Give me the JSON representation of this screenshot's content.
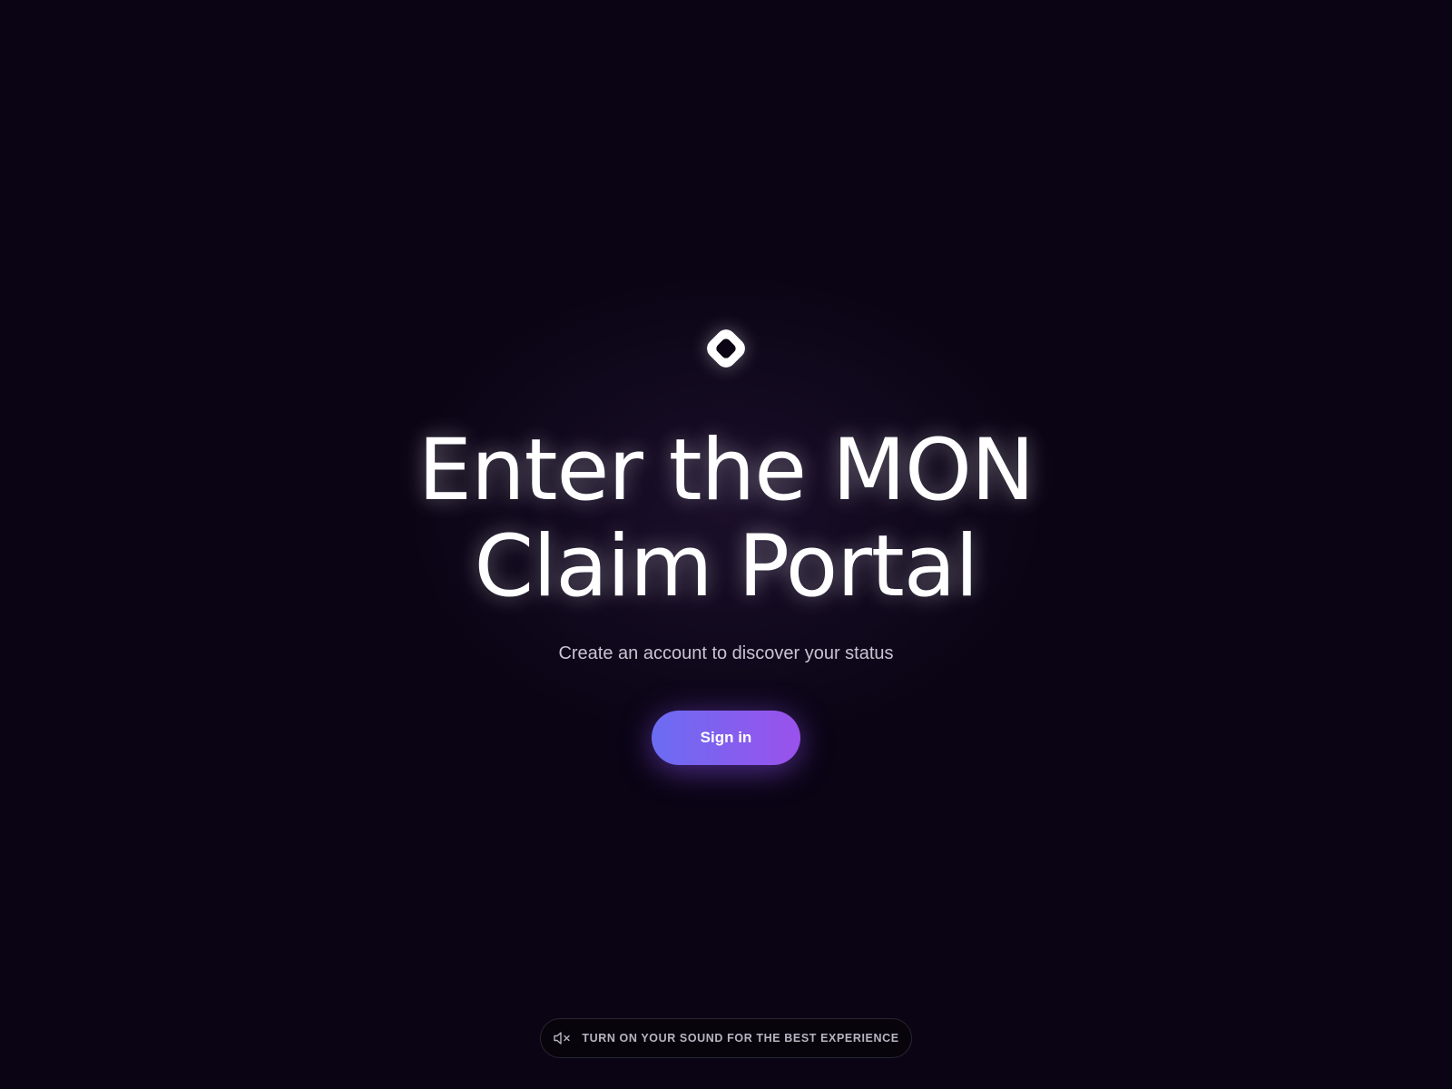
{
  "hero": {
    "logo_icon": "monad-diamond-logo-icon",
    "title_line1": "Enter the MON",
    "title_line2": "Claim Portal",
    "subtitle": "Create an account to discover your status"
  },
  "actions": {
    "signin_label": "Sign in"
  },
  "sound_banner": {
    "icon": "speaker-muted-icon",
    "label": "TURN ON YOUR SOUND FOR THE BEST EXPERIENCE"
  },
  "colors": {
    "background": "#0a0414",
    "button_gradient_start": "#6b6cf2",
    "button_gradient_end": "#9a52ec",
    "text_primary": "#ffffff",
    "text_secondary": "#c9c4d2"
  }
}
